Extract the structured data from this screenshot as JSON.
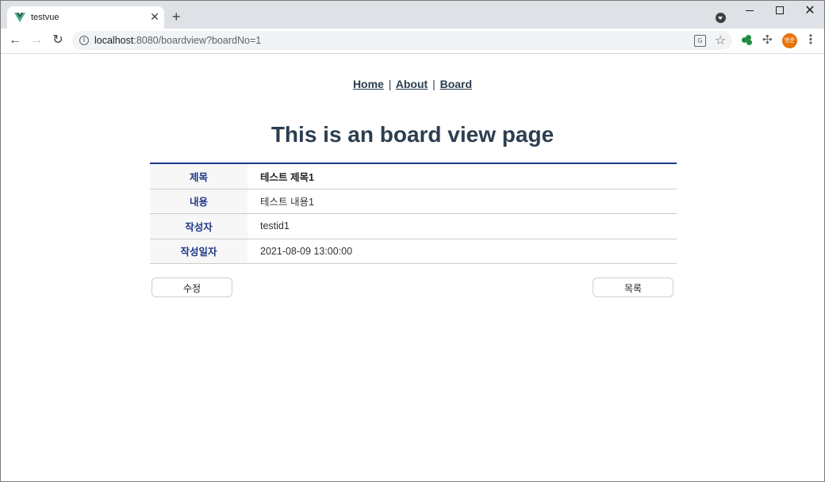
{
  "browser": {
    "tab_title": "testvue",
    "url_host": "localhost",
    "url_rest": ":8080/boardview?boardNo=1",
    "avatar_text": "병준",
    "accent_color": "#e8710a"
  },
  "nav": {
    "home": "Home",
    "sep1": "|",
    "about": "About",
    "sep2": "|",
    "board": "Board"
  },
  "page": {
    "title": "This is an board view page"
  },
  "board": {
    "rows": [
      {
        "label": "제목",
        "value": "테스트 제목1"
      },
      {
        "label": "내용",
        "value": "테스트 내용1"
      },
      {
        "label": "작성자",
        "value": "testid1"
      },
      {
        "label": "작성일자",
        "value": "2021-08-09 13:00:00"
      }
    ]
  },
  "buttons": {
    "edit": "수정",
    "list": "목록"
  },
  "colors": {
    "text": "#2c3e50",
    "table_header": "#1e3a8a"
  }
}
